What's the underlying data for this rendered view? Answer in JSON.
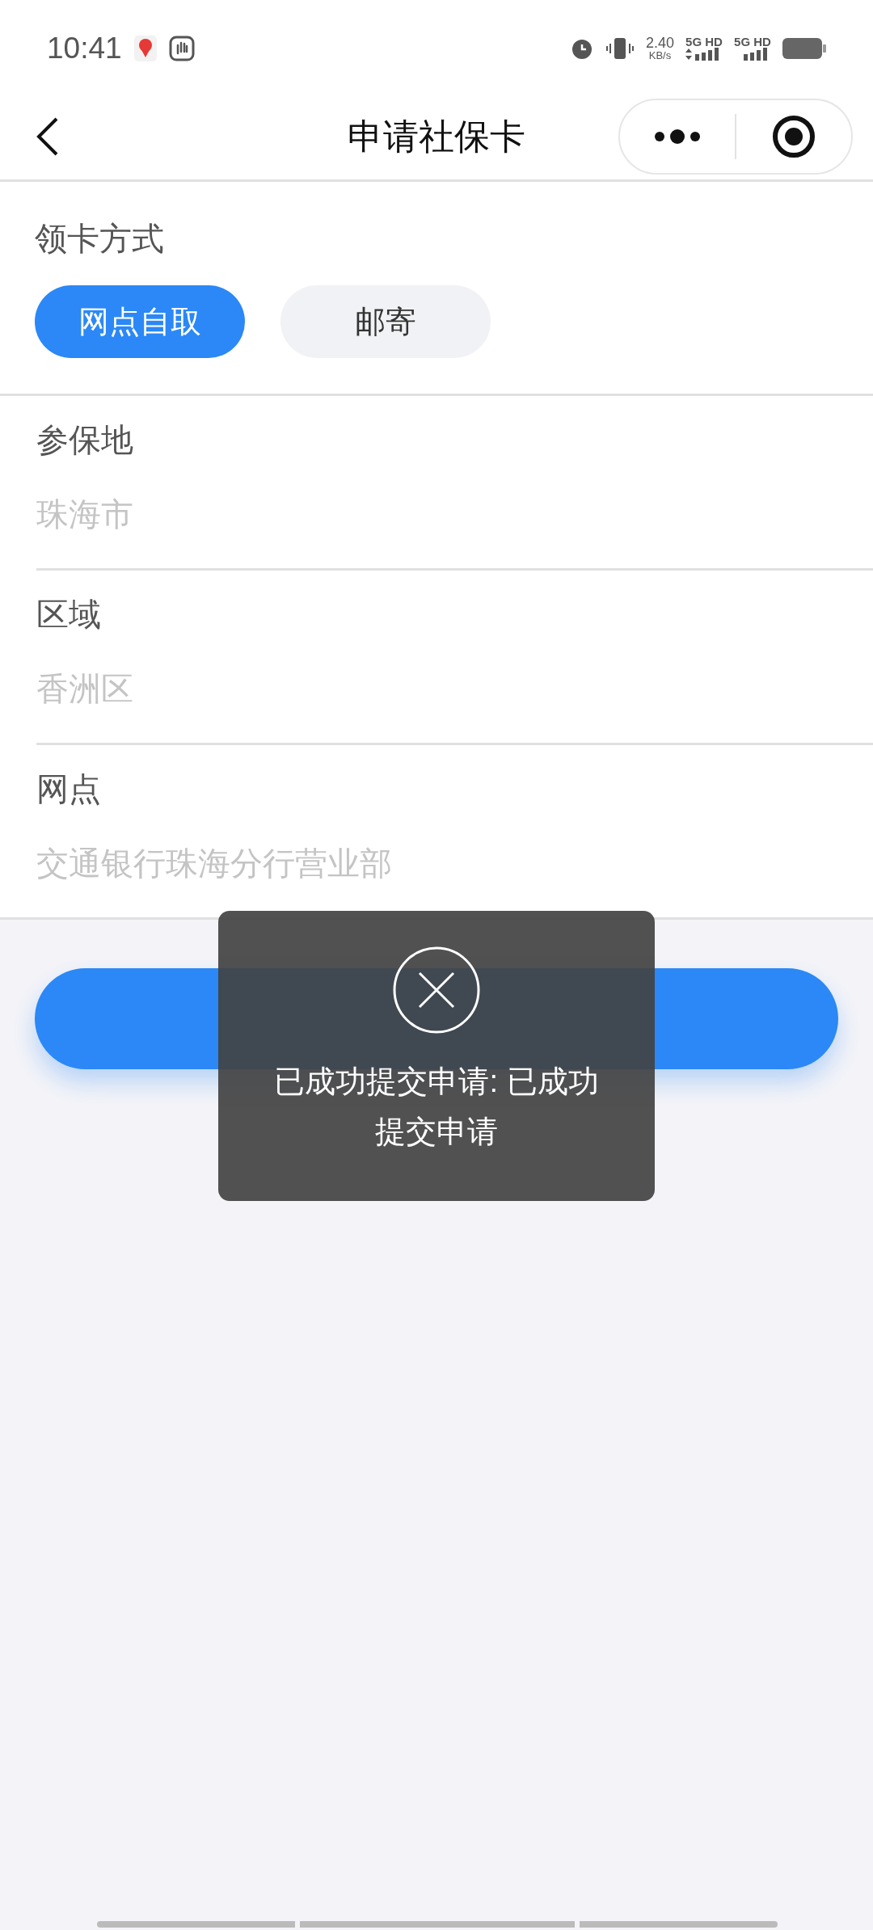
{
  "status_bar": {
    "time": "10:41",
    "net_speed": "2.40",
    "net_unit": "KB/s",
    "sim_1": "5G HD",
    "sim_2": "5G HD"
  },
  "nav": {
    "title": "申请社保卡"
  },
  "pickup": {
    "label": "领卡方式",
    "options": [
      {
        "label": "网点自取",
        "selected": true
      },
      {
        "label": "邮寄",
        "selected": false
      }
    ]
  },
  "fields": [
    {
      "label": "参保地",
      "value": "珠海市"
    },
    {
      "label": "区域",
      "value": "香洲区"
    },
    {
      "label": "网点",
      "value": "交通银行珠海分行营业部"
    }
  ],
  "submit": {
    "kind": "primary"
  },
  "toast": {
    "message": "已成功提交申请: 已成功提交申请"
  }
}
